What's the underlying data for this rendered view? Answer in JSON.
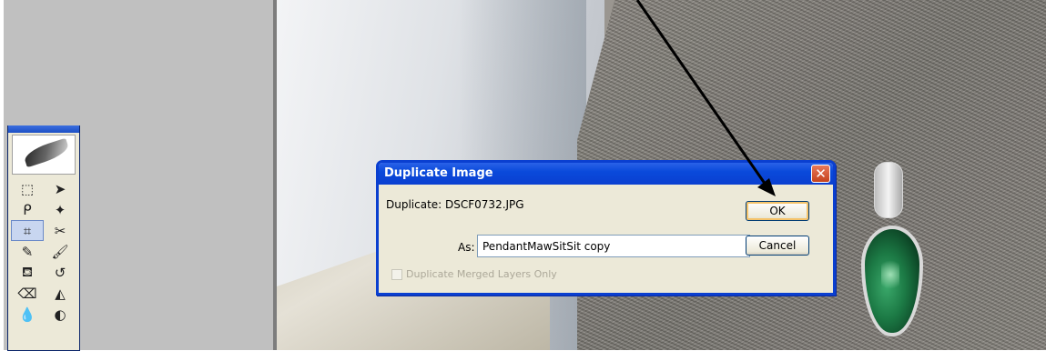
{
  "dialog": {
    "title": "Duplicate Image",
    "close_glyph": "✕",
    "duplicate_label": "Duplicate: DSCF0732.JPG",
    "as_label": "As:",
    "as_value": "PendantMawSitSit copy",
    "ok_label": "OK",
    "cancel_label": "Cancel",
    "merged_checkbox": {
      "label": "Duplicate Merged Layers Only",
      "checked": false,
      "enabled": false
    }
  },
  "toolbox": {
    "tools": [
      {
        "name": "marquee-tool-icon",
        "glyph": "⬚"
      },
      {
        "name": "move-tool-icon",
        "glyph": "➤"
      },
      {
        "name": "lasso-tool-icon",
        "glyph": "ᑭ"
      },
      {
        "name": "magic-wand-tool-icon",
        "glyph": "✦"
      },
      {
        "name": "crop-tool-icon",
        "glyph": "⌗"
      },
      {
        "name": "slice-tool-icon",
        "glyph": "✂"
      },
      {
        "name": "healing-brush-tool-icon",
        "glyph": "✎"
      },
      {
        "name": "brush-tool-icon",
        "glyph": "🖌"
      },
      {
        "name": "clone-stamp-tool-icon",
        "glyph": "⛾"
      },
      {
        "name": "history-brush-tool-icon",
        "glyph": "↺"
      },
      {
        "name": "eraser-tool-icon",
        "glyph": "⌫"
      },
      {
        "name": "paint-bucket-tool-icon",
        "glyph": "◭"
      },
      {
        "name": "blur-tool-icon",
        "glyph": "💧"
      },
      {
        "name": "dodge-tool-icon",
        "glyph": "◐"
      }
    ],
    "active_tool": "crop-tool-icon"
  },
  "colors": {
    "xp_title_blue": "#0a3fd0",
    "dialog_face": "#ece9d8",
    "workspace_grey": "#c0c0c0"
  }
}
